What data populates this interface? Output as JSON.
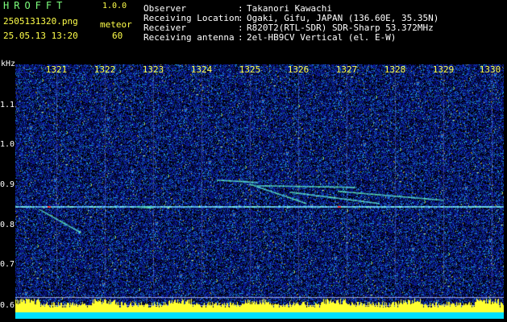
{
  "app": {
    "title": "HROFFT",
    "version": "1.0.0"
  },
  "file": {
    "name": "2505131320.png",
    "datetime": "25.05.13 13:20"
  },
  "mode": {
    "label": "meteor",
    "value": "60"
  },
  "info": {
    "rows": [
      {
        "key": "Observer",
        "value": "Takanori Kawachi"
      },
      {
        "key": "Receiving Location",
        "value": "Ogaki, Gifu, JAPAN (136.60E, 35.35N)"
      },
      {
        "key": "Receiver",
        "value": "R820T2(RTL-SDR) SDR-Sharp 53.372MHz"
      },
      {
        "key": "Receiving antenna",
        "value": "2el-HB9CV Vertical (el. E-W)"
      }
    ]
  },
  "axes": {
    "y_unit": "kHz",
    "y_ticks": [
      "1.1",
      "1.0",
      "0.9",
      "0.8",
      "0.7",
      "0.6"
    ],
    "x_ticks": [
      "1321",
      "1322",
      "1323",
      "1324",
      "1325",
      "1326",
      "1327",
      "1328",
      "1329",
      "1330"
    ]
  },
  "colors": {
    "background": "#000000",
    "noise": "#0a1a8c",
    "label_yellow": "#ffff4a",
    "label_green": "#7dff7d"
  }
}
